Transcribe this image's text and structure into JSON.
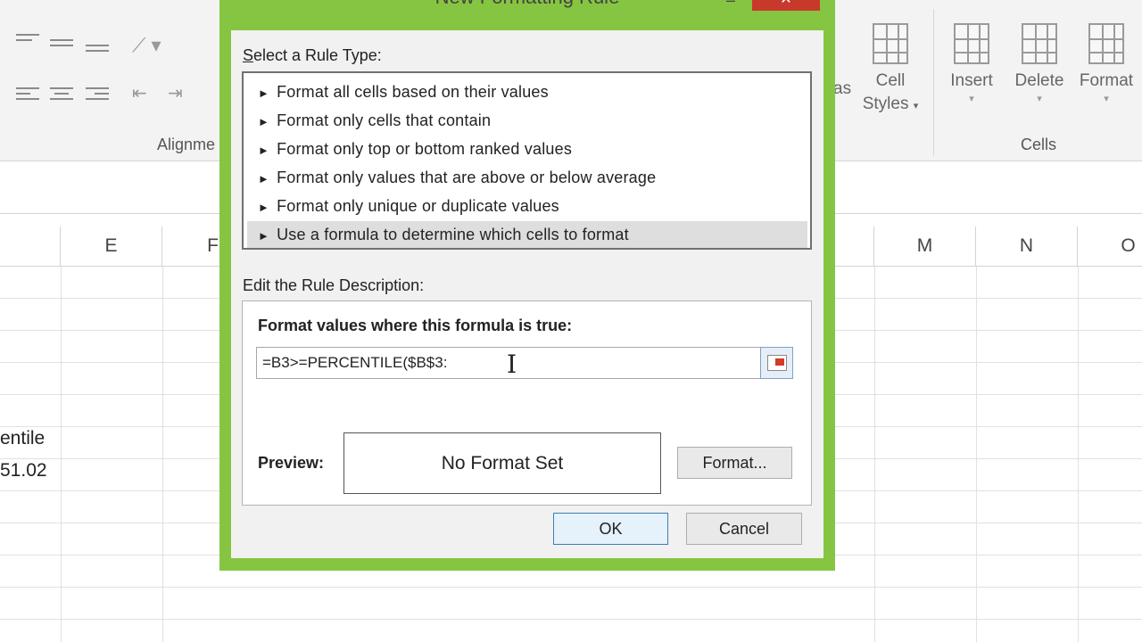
{
  "ribbon": {
    "alignment_group_label": "Alignme",
    "cells_group_label": "Cells",
    "styles_partial_label": "as",
    "buttons": {
      "cell_styles_line1": "Cell",
      "cell_styles_line2": "Styles",
      "insert": "Insert",
      "delete": "Delete",
      "format": "Format"
    }
  },
  "sheet": {
    "columns": [
      "E",
      "F",
      "M",
      "N",
      "O"
    ],
    "cells": {
      "percentile_label": "entile",
      "percentile_value": "51.02"
    }
  },
  "dialog": {
    "title": "New Formatting Rule",
    "select_rule_type_label": "Select a Rule Type:",
    "rule_types": [
      "Format all cells based on their values",
      "Format only cells that contain",
      "Format only top or bottom ranked values",
      "Format only values that are above or below average",
      "Format only unique or duplicate values",
      "Use a formula to determine which cells to format"
    ],
    "selected_rule_index": 5,
    "edit_description_label": "Edit the Rule Description:",
    "formula_heading": "Format values where this formula is true:",
    "formula_value": "=B3>=PERCENTILE($B$3:",
    "preview_label": "Preview:",
    "preview_text": "No Format Set",
    "format_button": "Format...",
    "ok_button": "OK",
    "cancel_button": "Cancel"
  },
  "colors": {
    "dialog_border": "#86c541",
    "close_button": "#c8392b",
    "selected_row": "#dedede"
  }
}
